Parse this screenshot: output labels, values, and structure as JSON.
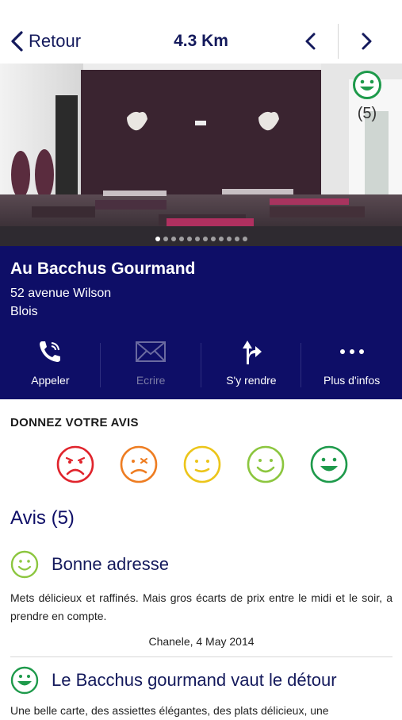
{
  "header": {
    "back_label": "Retour",
    "distance": "4.3 Km"
  },
  "photo": {
    "rating_count": "(5)",
    "slides_total": 12,
    "slide_active": 1
  },
  "place": {
    "name": "Au Bacchus Gourmand",
    "address": "52 avenue Wilson",
    "city": "Blois"
  },
  "actions": [
    {
      "label": "Appeler",
      "icon": "phone-icon",
      "enabled": true
    },
    {
      "label": "Ecrire",
      "icon": "envelope-icon",
      "enabled": false
    },
    {
      "label": "S'y rendre",
      "icon": "directions-icon",
      "enabled": true
    },
    {
      "label": "Plus d'infos",
      "icon": "more-icon",
      "enabled": true
    }
  ],
  "feedback": {
    "title": "DONNEZ VOTRE AVIS",
    "levels": [
      {
        "name": "very-bad",
        "color": "#e0242c"
      },
      {
        "name": "bad",
        "color": "#ee7d22"
      },
      {
        "name": "neutral",
        "color": "#ecc51a"
      },
      {
        "name": "good",
        "color": "#8cc63f"
      },
      {
        "name": "very-good",
        "color": "#1e9a4b"
      }
    ]
  },
  "reviews": {
    "title": "Avis (5)",
    "items": [
      {
        "title": "Bonne adresse",
        "text": "Mets délicieux et raffinés.  Mais gros écarts de prix entre le midi et le soir, a prendre en compte.",
        "author": "Chanele, 4 May 2014",
        "mood": "good"
      },
      {
        "title": "Le Bacchus gourmand vaut le détour",
        "text": "Une belle carte, des assiettes élégantes, des plats délicieux, une",
        "author": "",
        "mood": "very-good"
      }
    ]
  },
  "colors": {
    "brand": "#0e0e67",
    "title_text": "#141a5c"
  }
}
